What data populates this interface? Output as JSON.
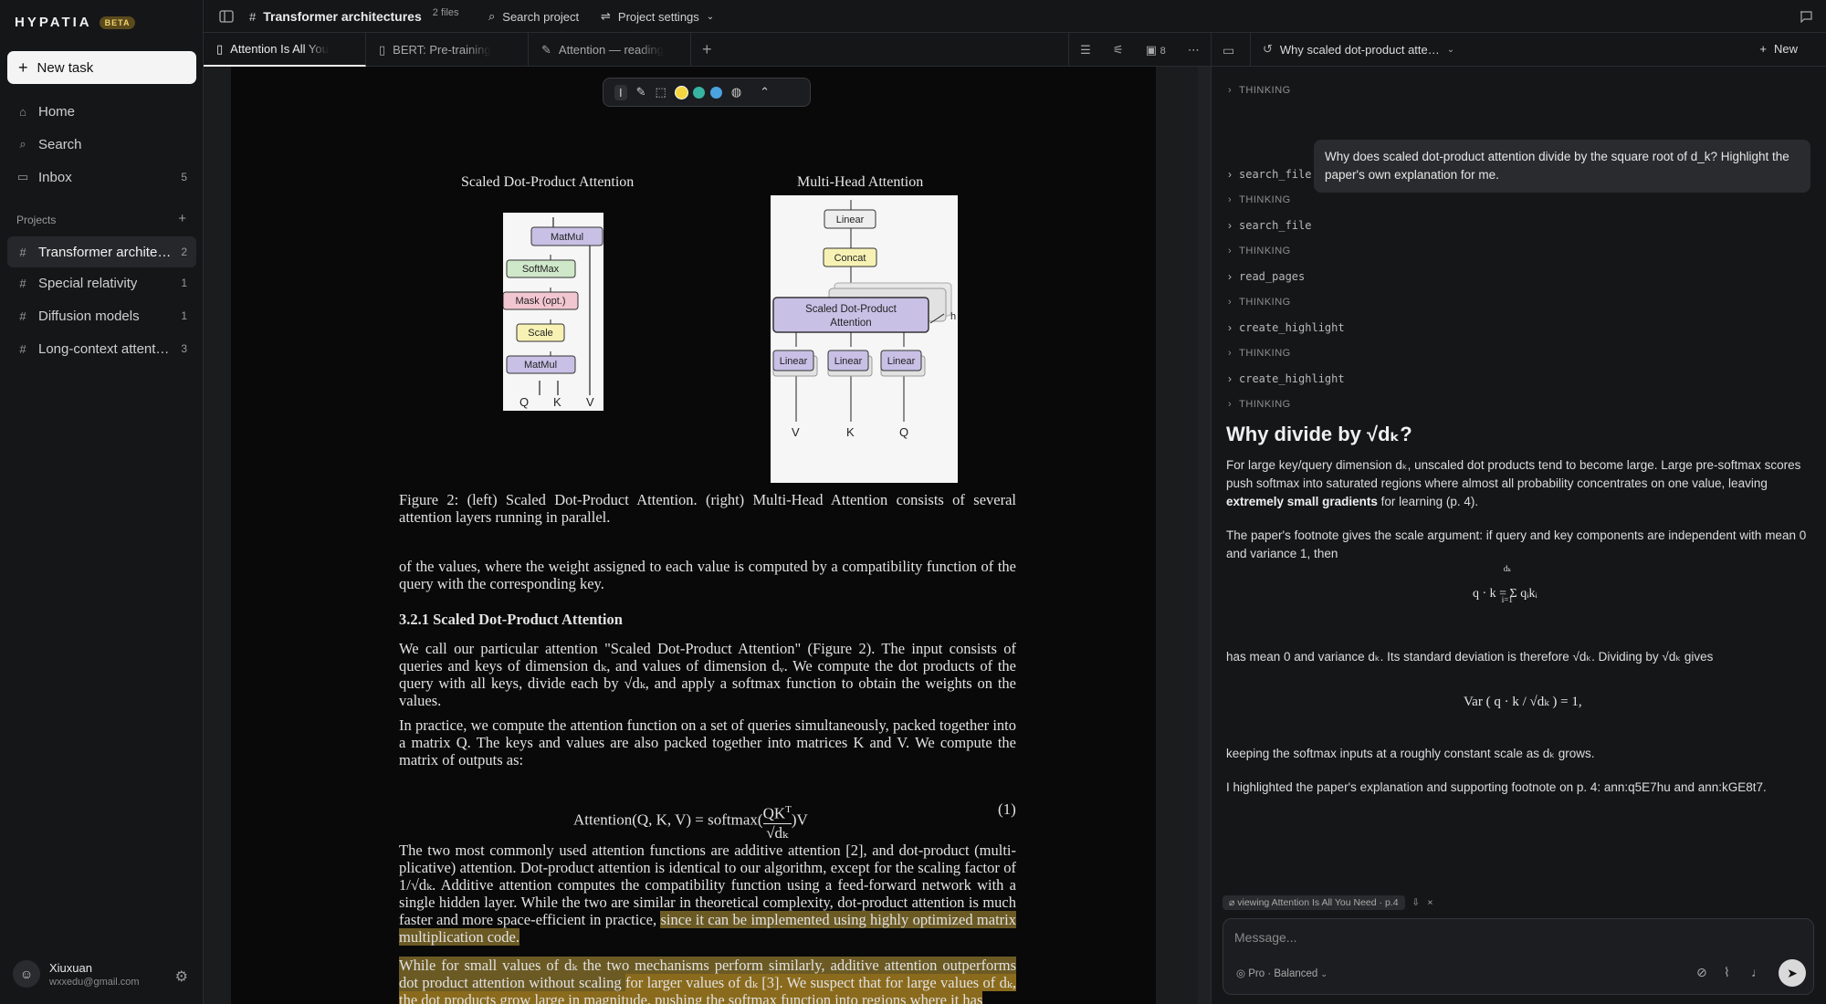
{
  "app": {
    "logo": "HYPATIA",
    "beta": "BETA"
  },
  "sidebar": {
    "new_task": "New task",
    "nav": [
      {
        "label": "Home",
        "icon": "home-icon"
      },
      {
        "label": "Search",
        "icon": "search-icon"
      },
      {
        "label": "Inbox",
        "icon": "inbox-icon",
        "count": "5"
      }
    ],
    "projects_heading": "Projects",
    "projects": [
      {
        "label": "Transformer archite…",
        "count": "2"
      },
      {
        "label": "Special relativity",
        "count": "1"
      },
      {
        "label": "Diffusion models",
        "count": "1"
      },
      {
        "label": "Long-context attent…",
        "count": "3"
      }
    ],
    "user": {
      "name": "Xiuxuan",
      "email": "wxxedu@gmail.com"
    }
  },
  "topbar": {
    "title": "Transformer architectures",
    "files": "2 files",
    "search": "Search project",
    "settings": "Project settings"
  },
  "tabs": [
    {
      "label": "Attention Is All You"
    },
    {
      "label": "BERT: Pre-training"
    },
    {
      "label": "Attention — reading"
    }
  ],
  "tab_tools": {
    "pages": "8"
  },
  "document": {
    "fig_left_title": "Scaled Dot-Product Attention",
    "fig_right_title": "Multi-Head Attention",
    "fig_left_boxes": [
      "MatMul",
      "SoftMax",
      "Mask (opt.)",
      "Scale",
      "MatMul"
    ],
    "fig_left_inputs": [
      "Q",
      "K",
      "V"
    ],
    "fig_right_boxes": {
      "top": "Linear",
      "concat": "Concat",
      "sdpa": "Scaled Dot-Product Attention",
      "h": "h",
      "linears": [
        "Linear",
        "Linear",
        "Linear"
      ]
    },
    "fig_right_inputs": [
      "V",
      "K",
      "Q"
    ],
    "caption": "Figure 2:  (left) Scaled Dot-Product Attention.  (right) Multi-Head Attention consists of several attention layers running in parallel.",
    "para1": "of the values, where the weight assigned to each value is computed by a compatibility function of the query with the corresponding key.",
    "section": "3.2.1    Scaled Dot-Product Attention",
    "para2": "We call our particular attention \"Scaled Dot-Product Attention\" (Figure 2). The input consists of queries and keys of dimension dₖ, and values of dimension dᵥ. We compute the dot products of the query with all keys, divide each by √dₖ, and apply a softmax function to obtain the weights on the values.",
    "para3": "In practice, we compute the attention function on a set of queries simultaneously, packed together into a matrix Q. The keys and values are also packed together into matrices K and V. We compute the matrix of outputs as:",
    "eq_lhs": "Attention(Q, K, V) = softmax(",
    "eq_num": "QK",
    "eq_sup": "T",
    "eq_den": "√dₖ",
    "eq_rhs": ")V",
    "eq_tag": "(1)",
    "para4a": "The two most commonly used attention functions are additive attention [2], and dot-product (multi-plicative) attention. Dot-product attention is identical to our algorithm, except for the scaling factor of 1/√dₖ. Additive attention computes the compatibility function using a feed-forward network with a single hidden layer. While the two are similar in theoretical complexity, dot-product attention is much faster and more space-efficient in practice, ",
    "para4b": "since it can be implemented using highly optimized matrix multiplication code.",
    "para5a": "While for small values of dₖ the two mechanisms perform similarly, additive attention outperforms dot product attention without scaling ",
    "para5b": "for larger values of dₖ [3]. We suspect that for large values of dₖ, the dot products grow large in magnitude, pushing the softmax function into regions where it has"
  },
  "chat": {
    "header_title": "Why scaled dot-product atte…",
    "header_new": "New",
    "steps": [
      {
        "label": "THINKING",
        "kind": "thinking"
      },
      {
        "label": "search_file",
        "kind": "tool"
      },
      {
        "label": "THINKING",
        "kind": "thinking"
      },
      {
        "label": "search_file",
        "kind": "tool"
      },
      {
        "label": "THINKING",
        "kind": "thinking"
      },
      {
        "label": "read_pages",
        "kind": "tool"
      },
      {
        "label": "THINKING",
        "kind": "thinking"
      },
      {
        "label": "create_highlight",
        "kind": "tool"
      },
      {
        "label": "THINKING",
        "kind": "thinking"
      },
      {
        "label": "create_highlight",
        "kind": "tool"
      },
      {
        "label": "THINKING",
        "kind": "thinking"
      }
    ],
    "first_thinking": "THINKING",
    "user_message": "Why does scaled dot-product attention divide by the square root of d_k? Highlight the paper's own explanation for me.",
    "answer_title": "Why divide by √dₖ?",
    "answer_p1": "For large key/query dimension dₖ, unscaled dot products tend to become large. Large pre-softmax scores push softmax into saturated regions where almost all probability concentrates on one value, leaving ",
    "answer_p1_bold": "extremely small gradients",
    "answer_p1_end": " for learning (p. 4).",
    "answer_p2": "The paper's footnote gives the scale argument: if query and key components are independent with mean 0 and variance 1, then",
    "answer_eq1": "q · k = Σ qᵢkᵢ",
    "answer_eq1_top": "dₖ",
    "answer_eq1_bottom": "i=1",
    "answer_p3": "has mean 0 and variance dₖ. Its standard deviation is therefore √dₖ. Dividing by √dₖ gives",
    "answer_eq2": "Var ( q · k / √dₖ ) = 1,",
    "answer_p4": "keeping the softmax inputs at a roughly constant scale as dₖ grows.",
    "answer_p5": "I highlighted the paper's explanation and supporting footnote on p. 4: ann:q5E7hu and ann:kGE8t7.",
    "context_chip": "viewing Attention Is All You Need · p.4",
    "composer_placeholder": "Message...",
    "composer_mode": "Pro · Balanced"
  },
  "colors": {
    "highlight_light": "#6b5a24",
    "highlight_dark": "#8a6a1c",
    "swatches": [
      "#f5d640",
      "#36b3a2",
      "#4aa3e0"
    ]
  }
}
